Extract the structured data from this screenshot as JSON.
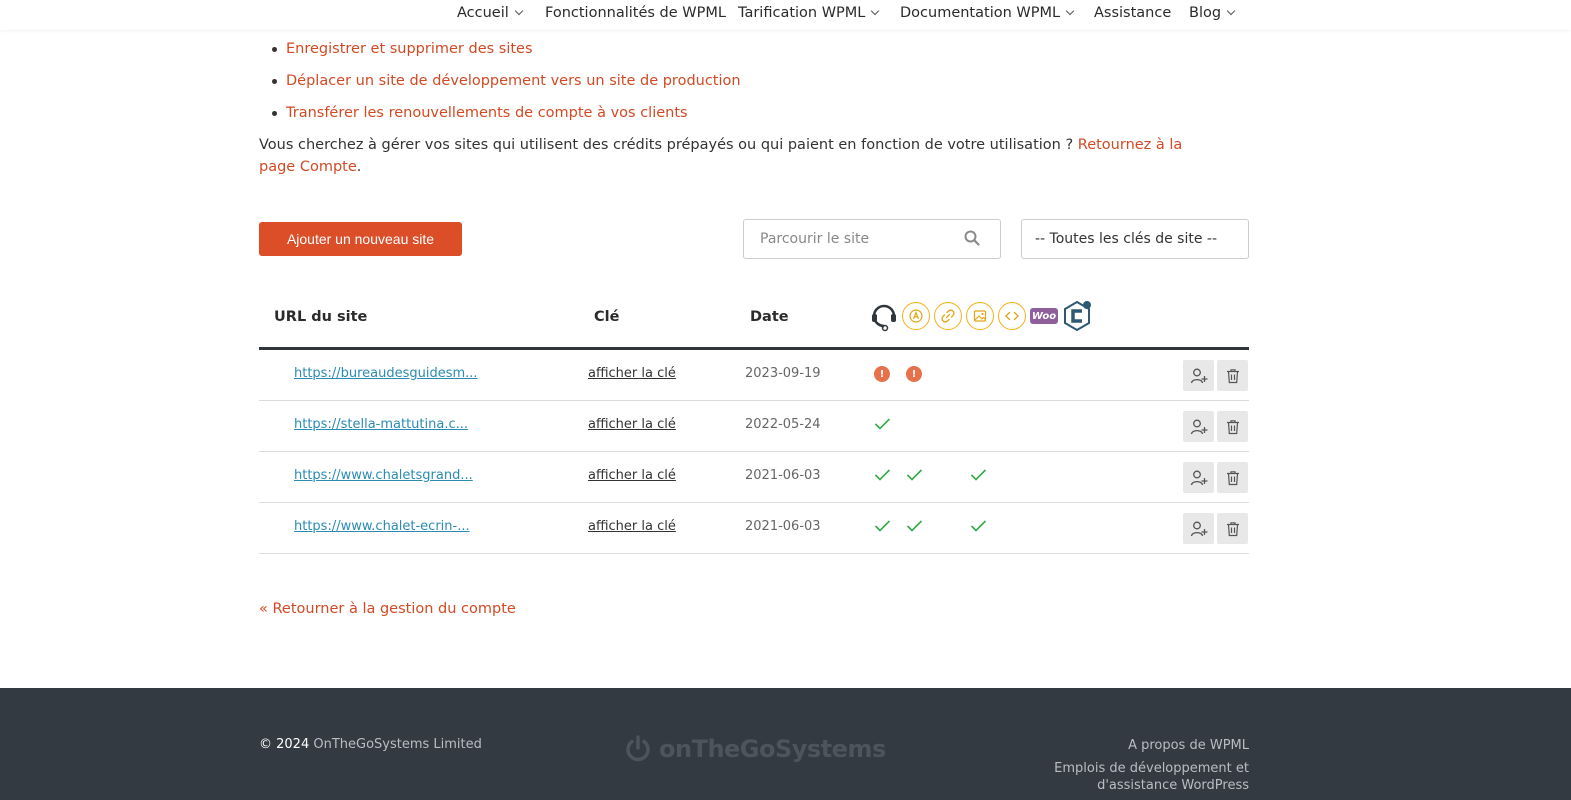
{
  "nav": {
    "items": [
      {
        "label": "Accueil",
        "dropdown": true
      },
      {
        "label": "Fonctionnalités de WPML",
        "dropdown": false
      },
      {
        "label": "Tarification WPML",
        "dropdown": true
      },
      {
        "label": "Documentation WPML",
        "dropdown": true
      },
      {
        "label": "Assistance",
        "dropdown": false
      },
      {
        "label": "Blog",
        "dropdown": true
      }
    ]
  },
  "bullets": [
    "Enregistrer et supprimer des sites",
    "Déplacer un site de développement vers un site de production",
    "Transférer les renouvellements de compte à vos clients"
  ],
  "intro": {
    "text": "Vous cherchez à gérer vos sites qui utilisent des crédits prépayés ou qui paient en fonction de votre utilisation ? ",
    "link": "Retournez à la page Compte",
    "end": "."
  },
  "toolbar": {
    "add_label": "Ajouter un nouveau site",
    "search_placeholder": "Parcourir le site",
    "select_value": "-- Toutes les clés de site --"
  },
  "table": {
    "headers": {
      "url": "URL du site",
      "key": "Clé",
      "date": "Date"
    },
    "header_icons": [
      "support-headset-icon",
      "translation-icon",
      "link-icon",
      "image-icon",
      "code-icon",
      "woocommerce-icon",
      "toolset-icon"
    ],
    "rows": [
      {
        "url": "https://bureaudesguidesm...",
        "key": "afficher la clé",
        "date": "2023-09-19",
        "status": [
          "alert",
          "alert",
          "",
          ""
        ]
      },
      {
        "url": "https://stella-mattutina.c...",
        "key": "afficher la clé",
        "date": "2022-05-24",
        "status": [
          "check",
          "",
          "",
          ""
        ]
      },
      {
        "url": "https://www.chaletsgrand...",
        "key": "afficher la clé",
        "date": "2021-06-03",
        "status": [
          "check",
          "check",
          "",
          "check"
        ]
      },
      {
        "url": "https://www.chalet-ecrin-...",
        "key": "afficher la clé",
        "date": "2021-06-03",
        "status": [
          "check",
          "check",
          "",
          "check"
        ]
      }
    ]
  },
  "back_link": "« Retourner à la gestion du compte",
  "footer": {
    "copyright_prefix": "© 2024",
    "company": "OnTheGoSystems Limited",
    "logo_text": "onTheGoSystems",
    "links": [
      "A propos de WPML",
      "Emplois de développement et",
      "d'assistance WordPress"
    ]
  },
  "colors": {
    "accent": "#dc4e28",
    "link": "#d24a23",
    "url": "#2b8bb4",
    "check": "#36a84a",
    "alert": "#e6714a",
    "footer": "#333a41"
  }
}
